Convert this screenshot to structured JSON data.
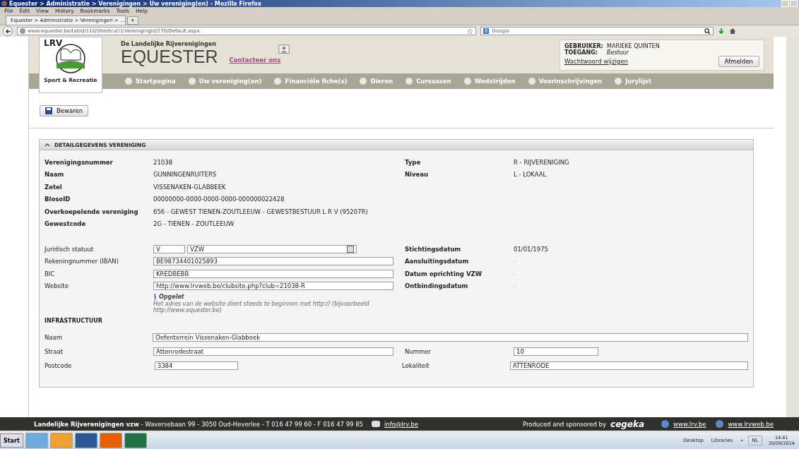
{
  "window": {
    "title": "Equester > Administratie > Verenigingen > Uw vereniging(en) - Mozilla Firefox"
  },
  "menu": [
    "File",
    "Edit",
    "View",
    "History",
    "Bookmarks",
    "Tools",
    "Help"
  ],
  "tab": {
    "label": "Equester > Administratie > Verenigingen > ...",
    "new_tab": "+"
  },
  "address": {
    "value": "www.equester.be/tabid/110/Shortcut/1/VerenigingId/270/Default.aspx"
  },
  "search": {
    "engine_label": "8",
    "value": "Google"
  },
  "header": {
    "logo_text": "LRV",
    "logo_caption": "Sport & Recreatie",
    "subtitle": "De Landelijke Rijverenigingen",
    "brand": "EQUESTER",
    "contact": "Contacteer ons"
  },
  "user_box": {
    "user_label": "GEBRUIKER:",
    "user": "MARIEKE QUINTEN",
    "access_label": "TOEGANG:",
    "access": "Bestuur",
    "change_password": "Wachtwoord wijzigen",
    "logout": "Afmelden"
  },
  "nav": [
    {
      "label": "Startpagina"
    },
    {
      "label": "Uw vereniging(en)"
    },
    {
      "label": "Financiële fiche(s)"
    },
    {
      "label": "Dieren"
    },
    {
      "label": "Cursussen"
    },
    {
      "label": "Wedstrijden"
    },
    {
      "label": "Voorinschrijvingen"
    },
    {
      "label": "Jurylijst"
    }
  ],
  "save_button": "Bewaren",
  "section": {
    "title": "DETAILGEGEVENS VERENIGING",
    "expanded": true
  },
  "details": [
    {
      "label": "Verenigingsnummer",
      "value": "21038",
      "right_label": "Type",
      "right_value": "R - RIJVERENIGING"
    },
    {
      "label": "Naam",
      "value": "GUNNINGENRUITERS",
      "right_label": "Niveau",
      "right_value": "L - LOKAAL"
    },
    {
      "label": "Zetel",
      "value": "VISSENAKEN-GLABBEEK"
    },
    {
      "label": "BlosoID",
      "value": "00000000-0000-0000-0000-000000022428"
    },
    {
      "label": "Overkoepelende vereniging",
      "value": "656 - GEWEST TIENEN-ZOUTLEEUW - GEWESTBESTUUR L R V (95207R)"
    },
    {
      "label": "Gewestcode",
      "value": "2G - TIENEN - ZOUTLEEUW"
    }
  ],
  "form": [
    {
      "kind": "select",
      "label": "Juridisch statuut",
      "code": "V",
      "value": "VZW",
      "right_label": "Stichtingsdatum",
      "right_value": "01/01/1975"
    },
    {
      "kind": "field",
      "label": "Rekeningnummer (IBAN)",
      "value": "BE98734401025893",
      "right_label": "Aansluitingsdatum",
      "right_value": "-"
    },
    {
      "kind": "field",
      "label": "BIC",
      "value": "KREDBEBB",
      "right_label": "Datum oprichting VZW",
      "right_value": "-"
    },
    {
      "kind": "field",
      "label": "Website",
      "value": "http://www.lrvweb.be/clubsite.php?club=21038-R",
      "right_label": "Ontbindingsdatum",
      "right_value": "-"
    }
  ],
  "note": {
    "title": "Opgelet",
    "text": "Het adres van de website dient steeds te beginnen met http:// (bijvoorbeeld http://www.equester.be)"
  },
  "infra": {
    "title": "INFRASTRUCTUUR",
    "rows": [
      {
        "kind": "wide",
        "label": "Naam",
        "value": "Oefenterrein Vissenaken-Glabbeek"
      },
      {
        "kind": "field",
        "label": "Straat",
        "value": "Attenrodestraat",
        "right_label": "Nummer",
        "right_value": "10"
      },
      {
        "kind": "short",
        "label": "Postcode",
        "value": "3384",
        "right_label": "Lokaliteit",
        "right_value": "ATTENRODE"
      }
    ]
  },
  "footer": {
    "org": "Landelijke Rijverenigingen vzw",
    "address": " - Waversebaan 99 - 3050 Oud-Heverlee - T 016 47 99 60 - F 016 47 99 85",
    "email": "info@lrv.be",
    "sponsor": "Produced and sponsored by",
    "sponsor_brand": "cegeka",
    "links": [
      "www.lrv.be",
      "www.lrvweb.be"
    ]
  },
  "taskbar": {
    "start": "Start",
    "desktop": "Desktop",
    "libraries": "Libraries",
    "chevron": "»",
    "lang": "NL",
    "time": "14:41",
    "date": "30/09/2014"
  }
}
